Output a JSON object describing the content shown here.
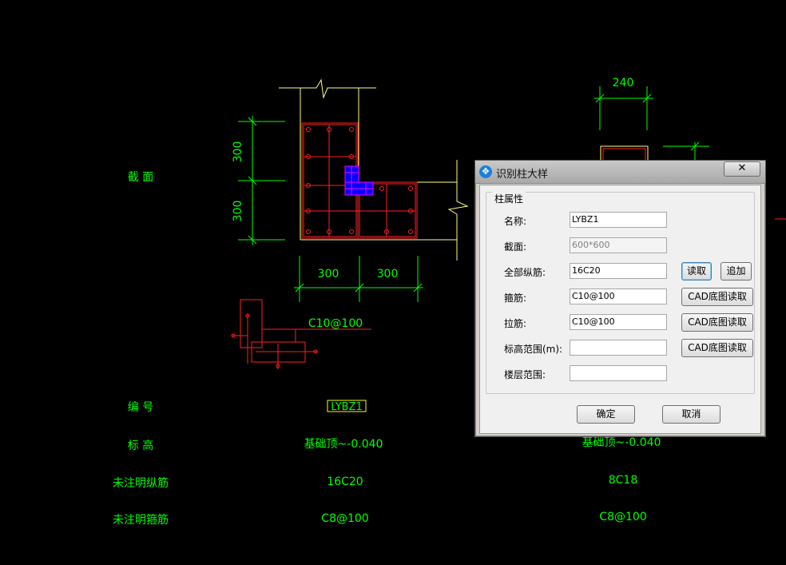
{
  "cad": {
    "row_labels": {
      "section": "截 面",
      "id": "编 号",
      "elevation": "标 高",
      "long_rebar": "未注明纵筋",
      "stirrup": "未注明箍筋"
    },
    "dimensions": {
      "v_top": "300",
      "v_bottom": "300",
      "h_left": "300",
      "h_right": "300",
      "right_top": "240"
    },
    "detail_label": "C10@100",
    "col1": {
      "id": "LYBZ1",
      "elevation": "基础顶~-0.040",
      "long_rebar": "16C20",
      "stirrup": "C8@100"
    },
    "col2": {
      "elevation": "基础顶~-0.040",
      "long_rebar": "8C18",
      "stirrup": "C8@100"
    },
    "colors": {
      "green": "#00ff00",
      "red": "#ff2020",
      "yellow": "#ffff80",
      "blue": "#0000ff"
    }
  },
  "dialog": {
    "title": "识别柱大样",
    "close_label": "✕",
    "group_title": "柱属性",
    "fields": {
      "name": {
        "label": "名称:",
        "value": "LYBZ1"
      },
      "section": {
        "label": "截面:",
        "value": "600*600"
      },
      "all_long_rebar": {
        "label": "全部纵筋:",
        "value": "16C20"
      },
      "stirrup": {
        "label": "箍筋:",
        "value": "C10@100"
      },
      "tie_bar": {
        "label": "拉筋:",
        "value": "C10@100"
      },
      "elevation_range": {
        "label": "标高范围(m):",
        "value": ""
      },
      "floor_range": {
        "label": "楼层范围:",
        "value": ""
      }
    },
    "buttons": {
      "read": "读取",
      "append": "追加",
      "cad_read_stirrup": "CAD底图读取",
      "cad_read_tie": "CAD底图读取",
      "cad_read_elev": "CAD底图读取",
      "ok": "确定",
      "cancel": "取消"
    }
  }
}
